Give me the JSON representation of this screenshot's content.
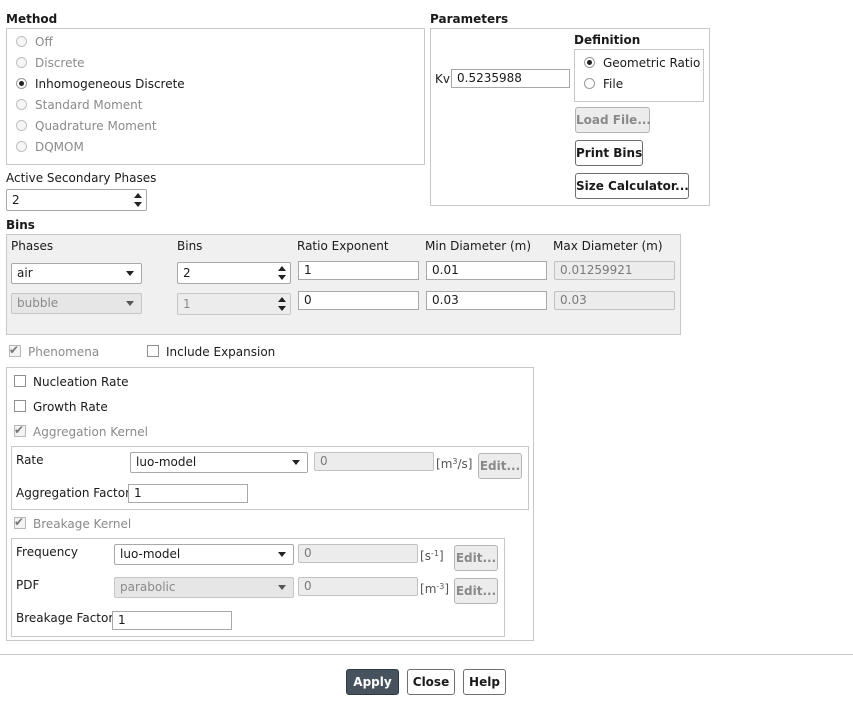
{
  "method": {
    "title": "Method",
    "options": [
      {
        "label": "Off",
        "selected": false,
        "enabled": false
      },
      {
        "label": "Discrete",
        "selected": false,
        "enabled": false
      },
      {
        "label": "Inhomogeneous Discrete",
        "selected": true,
        "enabled": true
      },
      {
        "label": "Standard Moment",
        "selected": false,
        "enabled": false
      },
      {
        "label": "Quadrature Moment",
        "selected": false,
        "enabled": false
      },
      {
        "label": "DQMOM",
        "selected": false,
        "enabled": false
      }
    ]
  },
  "parameters": {
    "title": "Parameters",
    "kv_label": "Kv",
    "kv_value": "0.5235988",
    "definition": {
      "title": "Definition",
      "geometric_ratio": "Geometric Ratio",
      "file": "File",
      "selected": "Geometric Ratio"
    },
    "load_file_button": "Load File...",
    "print_bins_button": "Print Bins",
    "size_calculator_button": "Size Calculator..."
  },
  "active_secondary_phases": {
    "label": "Active Secondary Phases",
    "value": "2"
  },
  "bins": {
    "title": "Bins",
    "headers": {
      "phases": "Phases",
      "bins": "Bins",
      "ratio_exponent": "Ratio Exponent",
      "min_diameter": "Min Diameter (m)",
      "max_diameter": "Max Diameter (m)"
    },
    "rows": [
      {
        "phase": "air",
        "bins": "2",
        "ratio_exponent": "1",
        "min_diameter": "0.01",
        "max_diameter": "0.01259921"
      },
      {
        "phase": "bubble",
        "bins": "1",
        "ratio_exponent": "0",
        "min_diameter": "0.03",
        "max_diameter": "0.03"
      }
    ]
  },
  "phenomena": {
    "label": "Phenomena",
    "include_expansion": "Include Expansion",
    "nucleation_rate": "Nucleation Rate",
    "growth_rate": "Growth Rate",
    "aggregation_kernel": "Aggregation Kernel",
    "aggregation": {
      "rate_label": "Rate",
      "rate_model": "luo-model",
      "rate_value": "0",
      "rate_unit": "m",
      "rate_unit_sup": "3",
      "rate_unit_tail": "/s",
      "edit_button": "Edit...",
      "factor_label": "Aggregation Factor",
      "factor_value": "1"
    },
    "breakage_kernel": "Breakage Kernel",
    "breakage": {
      "frequency_label": "Frequency",
      "frequency_model": "luo-model",
      "frequency_value": "0",
      "frequency_unit": "s",
      "frequency_unit_sup": "-1",
      "pdf_label": "PDF",
      "pdf_model": "parabolic",
      "pdf_value": "0",
      "pdf_unit": "m",
      "pdf_unit_sup": "-3",
      "edit_button": "Edit...",
      "factor_label": "Breakage Factor",
      "factor_value": "1"
    }
  },
  "footer": {
    "apply": "Apply",
    "close": "Close",
    "help": "Help"
  }
}
